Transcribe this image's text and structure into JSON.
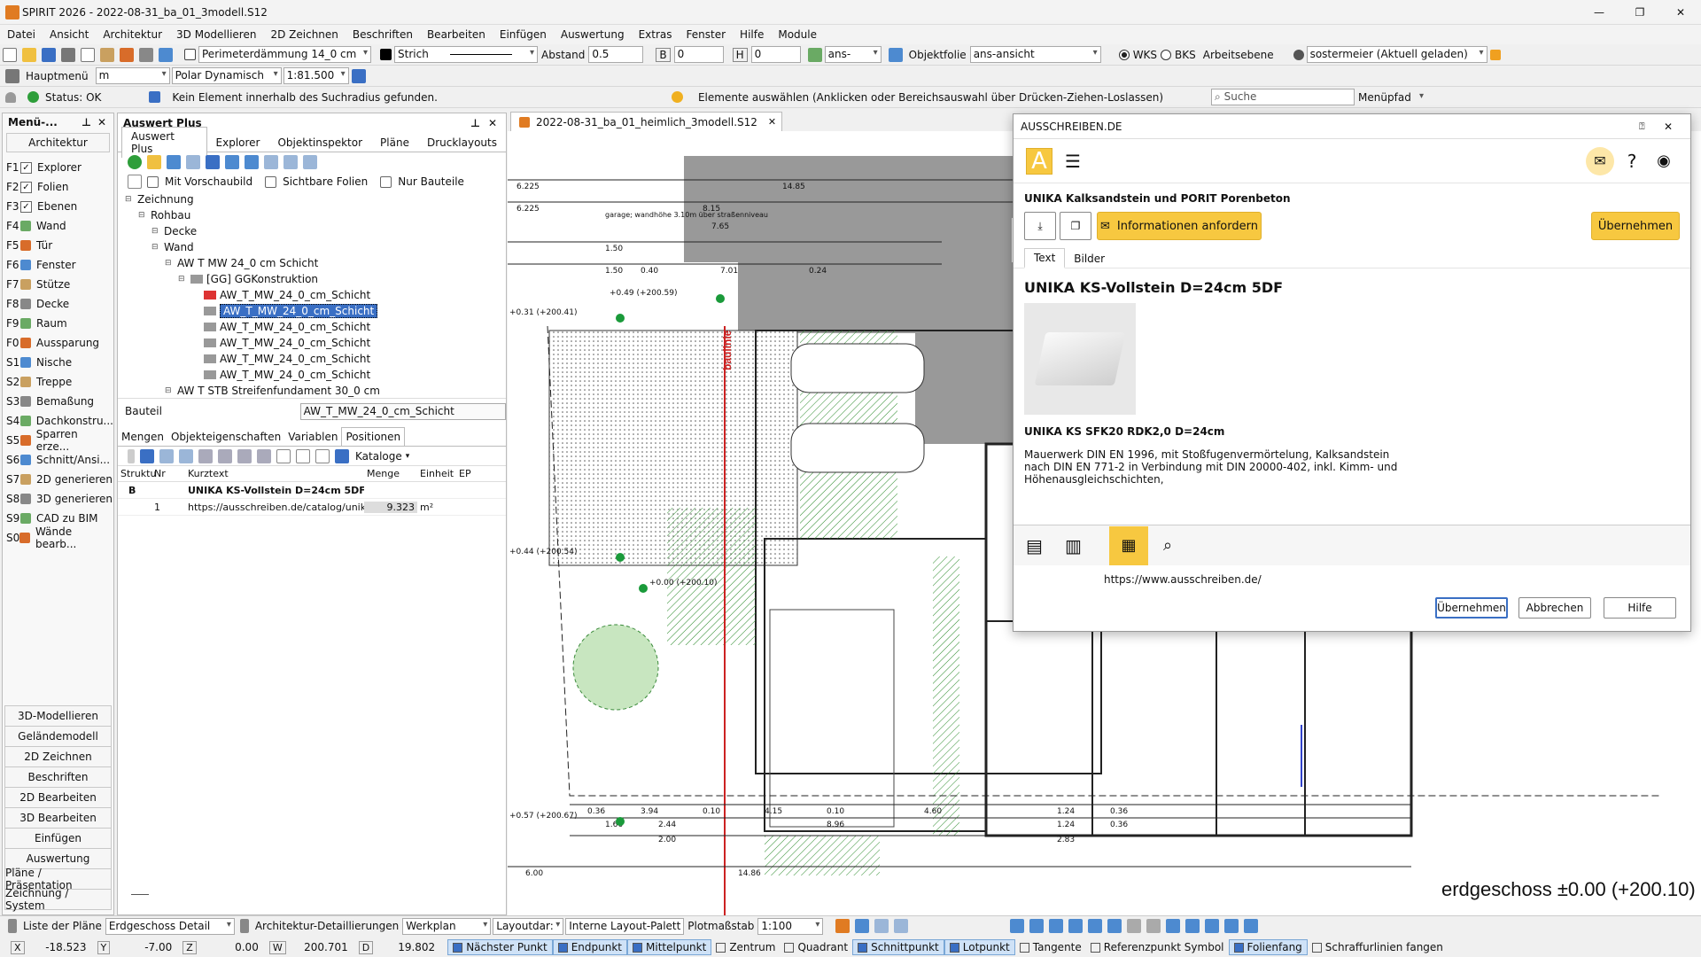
{
  "title_bar": {
    "text": "SPIRIT 2026  -  2022-08-31_ba_01_3modell.S12"
  },
  "menu": [
    "Datei",
    "Ansicht",
    "Architektur",
    "3D Modellieren",
    "2D Zeichnen",
    "Beschriften",
    "Bearbeiten",
    "Einfügen",
    "Auswertung",
    "Extras",
    "Fenster",
    "Hilfe",
    "Module"
  ],
  "toolbar1": {
    "layer": "Perimeterdämmung 14_0 cm",
    "linetype": "Strich",
    "abstand_label": "Abstand",
    "abstand": "0.5",
    "b_label": "B",
    "b_value": "0",
    "h_label": "H",
    "h_value": "0",
    "ans": "ans-",
    "objektfolie_label": "Objektfolie",
    "objektfolie": "ans-ansicht",
    "wks": "WKS",
    "bks": "BKS",
    "arbeitsebene": "Arbeitsebene",
    "user": "sostermeier (Aktuell geladen)"
  },
  "toolbar2": {
    "hauptmenu": "Hauptmenü",
    "unit": "m",
    "snap_mode": "Polar Dynamisch",
    "scale": "1:81.500"
  },
  "statusline": {
    "status": "Status: OK",
    "message": "Kein Element innerhalb des Suchradius gefunden.",
    "hint": "Elemente auswählen (Anklicken oder Bereichsauswahl über Drücken-Ziehen-Loslassen)",
    "search_placeholder": "Suche",
    "menupfad": "Menüpfad"
  },
  "menu_panel": {
    "title": "Menü-...",
    "category": "Architektur",
    "items": [
      {
        "key": "F1",
        "label": "Explorer",
        "check": true
      },
      {
        "key": "F2",
        "label": "Folien",
        "check": true
      },
      {
        "key": "F3",
        "label": "Ebenen",
        "check": true
      },
      {
        "key": "F4",
        "label": "Wand",
        "check": false
      },
      {
        "key": "F5",
        "label": "Tür",
        "check": false
      },
      {
        "key": "F6",
        "label": "Fenster",
        "check": false
      },
      {
        "key": "F7",
        "label": "Stütze",
        "check": false
      },
      {
        "key": "F8",
        "label": "Decke",
        "check": false
      },
      {
        "key": "F9",
        "label": "Raum",
        "check": false
      },
      {
        "key": "F0",
        "label": "Aussparung",
        "check": false
      },
      {
        "key": "S1",
        "label": "Nische",
        "check": false
      },
      {
        "key": "S2",
        "label": "Treppe",
        "check": false
      },
      {
        "key": "S3",
        "label": "Bemaßung",
        "check": false
      },
      {
        "key": "S4",
        "label": "Dachkonstru...",
        "check": false
      },
      {
        "key": "S5",
        "label": "Sparren erze...",
        "check": false
      },
      {
        "key": "S6",
        "label": "Schnitt/Ansi...",
        "check": false
      },
      {
        "key": "S7",
        "label": "2D generieren",
        "check": false
      },
      {
        "key": "S8",
        "label": "3D generieren",
        "check": false
      },
      {
        "key": "S9",
        "label": "CAD zu BIM",
        "check": false
      },
      {
        "key": "S0",
        "label": "Wände bearb...",
        "check": false
      }
    ],
    "sections": [
      "3D-Modellieren",
      "Geländemodell",
      "2D Zeichnen",
      "Beschriften",
      "2D Bearbeiten",
      "3D Bearbeiten",
      "Einfügen",
      "Auswertung",
      "Pläne / Präsentation",
      "Zeichnung / System"
    ]
  },
  "auswert": {
    "title": "Auswert Plus",
    "tabs": [
      "Auswert Plus",
      "Explorer",
      "Objektinspektor",
      "Pläne",
      "Drucklayouts"
    ],
    "opt_vorschau": "Mit Vorschaubild",
    "opt_sichtbar": "Sichtbare Folien",
    "opt_bauteile": "Nur Bauteile",
    "tree": [
      {
        "indent": 0,
        "label": "Zeichnung",
        "selected": false
      },
      {
        "indent": 1,
        "label": "Rohbau",
        "selected": false
      },
      {
        "indent": 2,
        "label": "Decke",
        "selected": false
      },
      {
        "indent": 2,
        "label": "Wand",
        "selected": false
      },
      {
        "indent": 3,
        "label": "AW T MW 24_0 cm Schicht",
        "selected": false
      },
      {
        "indent": 4,
        "label": "[GG] GGKonstruktion",
        "selected": false
      },
      {
        "indent": 5,
        "label": "AW_T_MW_24_0_cm_Schicht",
        "selected": false
      },
      {
        "indent": 5,
        "label": "AW_T_MW_24_0_cm_Schicht",
        "selected": true
      },
      {
        "indent": 5,
        "label": "AW_T_MW_24_0_cm_Schicht",
        "selected": false
      },
      {
        "indent": 5,
        "label": "AW_T_MW_24_0_cm_Schicht",
        "selected": false
      },
      {
        "indent": 5,
        "label": "AW_T_MW_24_0_cm_Schicht",
        "selected": false
      },
      {
        "indent": 5,
        "label": "AW_T_MW_24_0_cm_Schicht",
        "selected": false
      },
      {
        "indent": 3,
        "label": "AW T STB Streifenfundament 30_0 cm",
        "selected": false
      }
    ],
    "bauteil_label": "Bauteil",
    "bauteil_value": "AW_T_MW_24_0_cm_Schicht",
    "lower_tabs": [
      "Mengen",
      "Objekteigenschaften",
      "Variablen",
      "Positionen"
    ],
    "kataloge": "Kataloge",
    "grid_headers": [
      "Struktu",
      "Nr",
      "Kurztext",
      "Menge",
      "Einheit",
      "EP"
    ],
    "grid_rows": [
      {
        "struct": "B",
        "nr": "",
        "kurztext": "UNIKA KS-Vollstein D=24cm 5DF",
        "menge": "",
        "einheit": "",
        "bold": true
      },
      {
        "struct": "",
        "nr": "1",
        "kurztext": "https://ausschreiben.de/catalog/unika_p",
        "menge": "9.323",
        "einheit": "m²",
        "bold": false
      }
    ]
  },
  "doc_tab": "2022-08-31_ba_01_heimlich_3modell.S12",
  "drawing": {
    "floor_label": "erdgeschoss ±0.00 (+200.10)",
    "baulinie": "baulinie",
    "dims_top": [
      "6.225",
      "14.85",
      "6.225",
      "8.15",
      "7.65",
      "1.50",
      "1.50",
      "0.40",
      "7.01",
      "0.24"
    ],
    "dims_bottom": [
      "0.36",
      "3.94",
      "0.10",
      "4.15",
      "0.10",
      "4.60",
      "1.24",
      "0.36",
      "1.66",
      "2.44",
      "2.00",
      "8.96",
      "1.24",
      "0.36",
      "2.83",
      "6.00",
      "14.86"
    ],
    "level_marks": [
      "+0.31 (+200.41)",
      "+0.49 (+200.59)",
      "+0.44 (+200.54)",
      "+0.57 (+200.67)",
      "+0.00 (+200.10)"
    ],
    "garage_note": "garage; wandhöhe 3.10m über straßenniveau"
  },
  "popup": {
    "title": "AUSSCHREIBEN.DE",
    "logo": "A",
    "company": "UNIKA Kalksandstein und PORIT Porenbeton",
    "request_btn": "Informationen anfordern",
    "accept_top": "Übernehmen",
    "tabs": [
      "Text",
      "Bilder"
    ],
    "product_title": "UNIKA KS-Vollstein D=24cm 5DF",
    "product_code": "UNIKA KS  SFK20 RDK2,0 D=24cm",
    "description": "Mauerwerk DIN EN 1996, mit Stoßfugenvermörtelung, Kalksandstein nach DIN EN 771-2 in Verbindung mit DIN 20000-402, inkl. Kimm- und Höhenausgleichschichten,",
    "url": "https://www.ausschreiben.de/",
    "btn_ok": "Übernehmen",
    "btn_cancel": "Abbrechen",
    "btn_help": "Hilfe"
  },
  "bottom_bar": {
    "liste_label": "Liste der Pläne",
    "plan": "Erdgeschoss Detail",
    "detail_label": "Architektur-Detaillierungen",
    "detail": "Werkplan",
    "layout": "Layoutdar:",
    "palette": "Interne Layout-Palett",
    "plotmass_label": "Plotmaßstab",
    "plotmass": "1:100",
    "coords": [
      {
        "axis": "X",
        "value": "-18.523"
      },
      {
        "axis": "Y",
        "value": "-7.00"
      },
      {
        "axis": "Z",
        "value": "0.00"
      },
      {
        "axis": "W",
        "value": "200.701"
      },
      {
        "axis": "D",
        "value": "19.802"
      }
    ],
    "snaps": [
      {
        "label": "Nächster Punkt",
        "on": true
      },
      {
        "label": "Endpunkt",
        "on": true
      },
      {
        "label": "Mittelpunkt",
        "on": true
      },
      {
        "label": "Zentrum",
        "on": false
      },
      {
        "label": "Quadrant",
        "on": false
      },
      {
        "label": "Schnittpunkt",
        "on": true
      },
      {
        "label": "Lotpunkt",
        "on": true
      },
      {
        "label": "Tangente",
        "on": false
      },
      {
        "label": "Referenzpunkt Symbol",
        "on": false
      },
      {
        "label": "Folienfang",
        "on": true
      },
      {
        "label": "Schraffurlinien fangen",
        "on": false
      }
    ]
  },
  "colors": {
    "accent": "#f7c840",
    "selection": "#3a6fc4",
    "baulinie": "#cc2222"
  }
}
